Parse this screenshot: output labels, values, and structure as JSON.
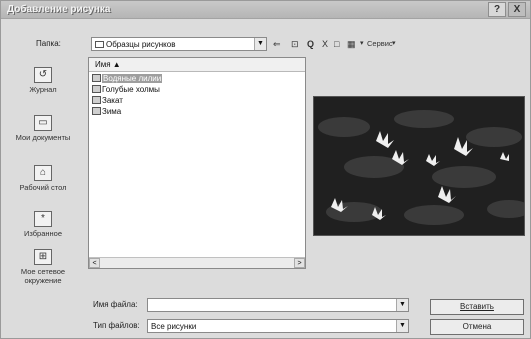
{
  "title": "Добавление рисунка",
  "titlebar": {
    "help_glyph": "?",
    "close_glyph": "X"
  },
  "folder": {
    "label": "Папка:",
    "value": "Образцы рисунков"
  },
  "toolbar": {
    "back": "⇐",
    "up": "⊡",
    "search": "Q",
    "delete": "X",
    "new_folder": "□",
    "views": "▦",
    "service": "Сервис"
  },
  "places": [
    {
      "icon": "history-icon",
      "glyph": "↺",
      "label": "Журнал"
    },
    {
      "icon": "my-documents-icon",
      "glyph": "▭",
      "label": "Мои документы"
    },
    {
      "icon": "desktop-icon",
      "glyph": "⌂",
      "label": "Рабочий стол"
    },
    {
      "icon": "favorites-icon",
      "glyph": "*",
      "label": "Избранное"
    },
    {
      "icon": "network-icon",
      "glyph": "⊞",
      "label": "Мое сетевое окружение"
    }
  ],
  "filelist": {
    "column_header": "Имя ▲",
    "files": [
      {
        "name": "Водяные лилии",
        "selected": true
      },
      {
        "name": "Голубые холмы",
        "selected": false
      },
      {
        "name": "Закат",
        "selected": false
      },
      {
        "name": "Зима",
        "selected": false
      }
    ],
    "scroll_left": "<",
    "scroll_right": ">"
  },
  "filename": {
    "label": "Имя файла:",
    "value": ""
  },
  "filetype": {
    "label": "Тип файлов:",
    "value": "Все рисунки"
  },
  "buttons": {
    "insert": "Вставить",
    "cancel": "Отмена"
  }
}
